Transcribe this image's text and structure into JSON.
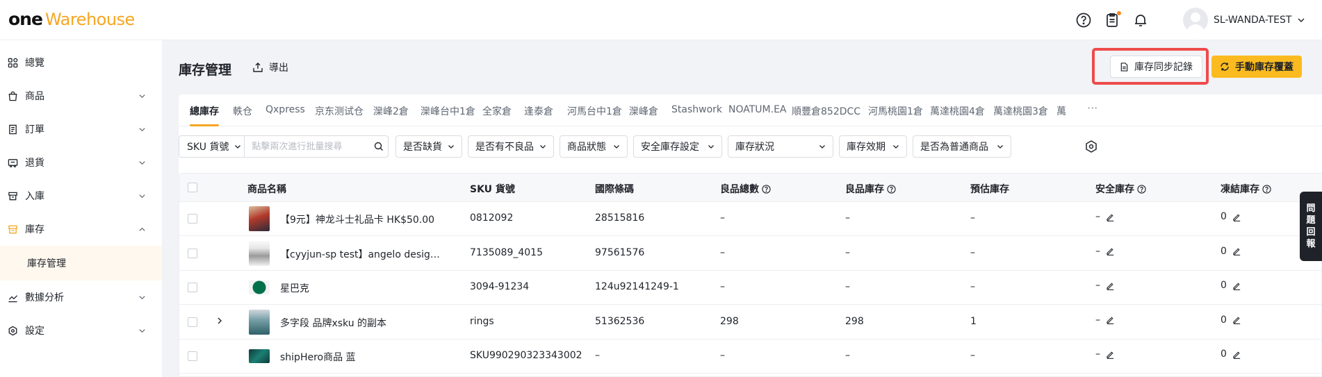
{
  "brand": {
    "logo_one": "one",
    "logo_warehouse": "Warehouse"
  },
  "header": {
    "icons": [
      "help-circle-icon",
      "clipboard-icon",
      "bell-icon"
    ],
    "username": "SL-WANDA-TEST",
    "accent_color": "#f6a623",
    "notification_dot_color": "#f5871f"
  },
  "sidebar": {
    "items": [
      {
        "label": "總覽",
        "icon": "dashboard-icon"
      },
      {
        "label": "商品",
        "icon": "shopping-bag-icon"
      },
      {
        "label": "訂單",
        "icon": "receipt-icon"
      },
      {
        "label": "退貨",
        "icon": "return-truck-icon"
      },
      {
        "label": "入庫",
        "icon": "inbound-icon"
      },
      {
        "label": "庫存",
        "icon": "inventory-icon"
      },
      {
        "label": "數據分析",
        "icon": "analytics-icon"
      },
      {
        "label": "設定",
        "icon": "settings-icon"
      }
    ],
    "active_sub": "庫存管理"
  },
  "page": {
    "title": "庫存管理",
    "export_label": "導出",
    "sync_log_label": "庫存同步記錄",
    "manual_cover_label": "手動庫存覆蓋",
    "highlight_color": "#ee4b4b",
    "primary_button_color": "#fbbb20"
  },
  "tabs": [
    "總庫存",
    "軼仓",
    "Qxpress",
    "京东测试仓",
    "灤峰2倉",
    "灤峰台中1倉",
    "全家倉",
    "逢泰倉",
    "河馬台中1倉",
    "灤峰倉",
    "Stashwork",
    "NOATUM.EA",
    "順豐倉852DCC",
    "河馬桃園1倉",
    "萬達桃園4倉",
    "萬達桃園3倉",
    "萬"
  ],
  "tab_more": "···",
  "filters": {
    "sku_select": "SKU 貨號",
    "sku_placeholder": "點擊兩次進行批量搜尋",
    "dropdowns": [
      "是否缺貨",
      "是否有不良品",
      "商品狀態",
      "安全庫存設定",
      "庫存狀況",
      "庫存效期",
      "是否為普通商品"
    ]
  },
  "table": {
    "columns": [
      "商品名稱",
      "SKU 貨號",
      "國際條碼",
      "良品總數",
      "良品庫存",
      "預估庫存",
      "安全庫存",
      "凍結庫存"
    ],
    "rows": [
      {
        "name": "【9元】神龙斗士礼品卡 HK$50.00",
        "sku": "0812092",
        "barcode": "28515816",
        "good_total": "–",
        "good_stock": "–",
        "estimated": "–",
        "safety": "–",
        "frozen": "0",
        "expandable": false,
        "thumb": "card"
      },
      {
        "name": "【cyyjun-sp test】angelo designed men's shirt",
        "sku": "7135089_4015",
        "barcode": "97561576",
        "good_total": "–",
        "good_stock": "–",
        "estimated": "–",
        "safety": "–",
        "frozen": "0",
        "expandable": false,
        "thumb": "shirt"
      },
      {
        "name": "星巴克",
        "sku": "3094-91234",
        "barcode": "124u92141249-1",
        "good_total": "–",
        "good_stock": "–",
        "estimated": "–",
        "safety": "–",
        "frozen": "0",
        "expandable": false,
        "thumb": "starbucks"
      },
      {
        "name": "多字段 品牌xsku 的副本",
        "sku": "rings",
        "barcode": "51362536",
        "good_total": "298",
        "good_stock": "298",
        "estimated": "1",
        "safety": "–",
        "frozen": "0",
        "expandable": true,
        "thumb": "bag"
      },
      {
        "name": "shipHero商品 蓝",
        "sku": "SKU990290323343002",
        "barcode": "–",
        "good_total": "–",
        "good_stock": "–",
        "estimated": "–",
        "safety": "–",
        "frozen": "0",
        "expandable": false,
        "thumb": "teal"
      }
    ]
  },
  "feedback": {
    "chars": [
      "問",
      "題",
      "回",
      "報"
    ]
  }
}
